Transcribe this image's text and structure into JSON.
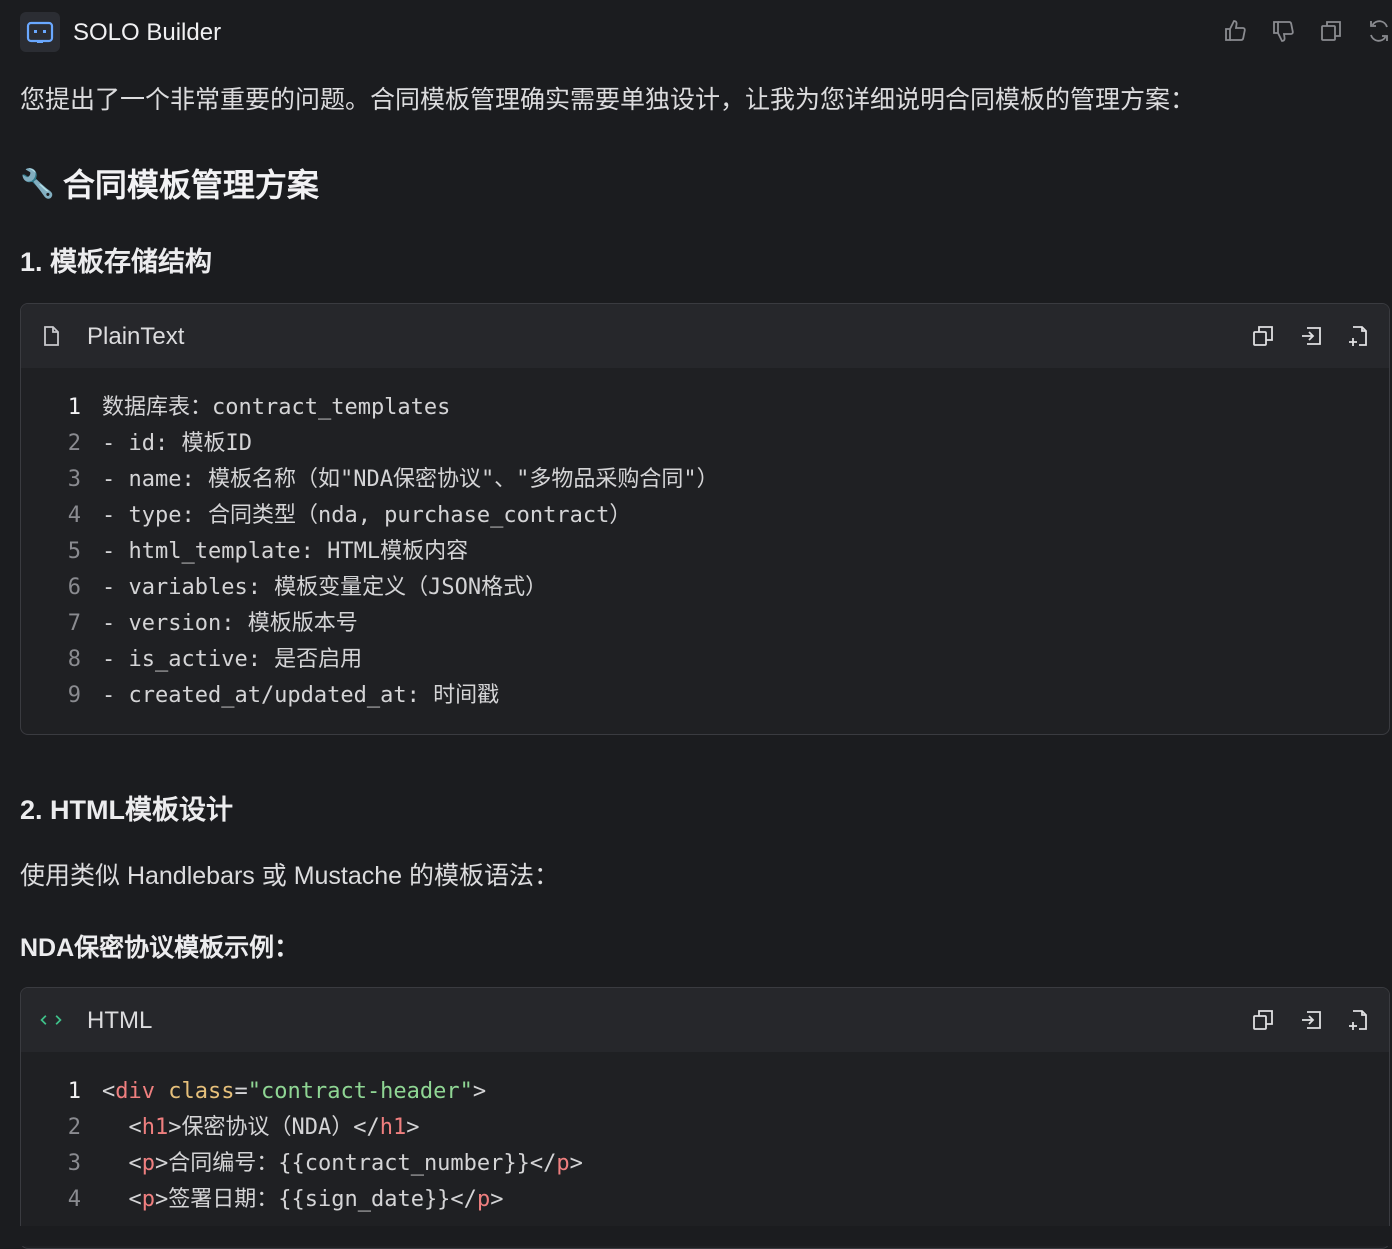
{
  "header": {
    "app_name": "SOLO Builder",
    "actions": [
      "thumbs-up",
      "thumbs-down",
      "copy",
      "regenerate"
    ]
  },
  "message": {
    "intro": "您提出了一个非常重要的问题。合同模板管理确实需要单独设计，让我为您详细说明合同模板的管理方案：",
    "section_title": "合同模板管理方案",
    "section_emoji": "🔧",
    "sub1_title": "1. 模板存储结构",
    "sub2_title": "2. HTML模板设计",
    "sub2_para": "使用类似 Handlebars 或 Mustache 的模板语法：",
    "sub2_bold": "NDA保密协议模板示例："
  },
  "code1": {
    "language": "PlainText",
    "lines": [
      "数据库表：contract_templates",
      "- id: 模板ID",
      "- name: 模板名称（如\"NDA保密协议\"、\"多物品采购合同\"）",
      "- type: 合同类型（nda, purchase_contract）",
      "- html_template: HTML模板内容",
      "- variables: 模板变量定义（JSON格式）",
      "- version: 模板版本号",
      "- is_active: 是否启用",
      "- created_at/updated_at: 时间戳"
    ]
  },
  "code2": {
    "language": "HTML",
    "lines": [
      [
        [
          "punc",
          "<"
        ],
        [
          "tag",
          "div"
        ],
        [
          "punc",
          " "
        ],
        [
          "attr",
          "class"
        ],
        [
          "punc",
          "="
        ],
        [
          "str",
          "\"contract-header\""
        ],
        [
          "punc",
          ">"
        ]
      ],
      [
        [
          "punc",
          "  <"
        ],
        [
          "tag",
          "h1"
        ],
        [
          "punc",
          ">保密协议（NDA）</"
        ],
        [
          "tag",
          "h1"
        ],
        [
          "punc",
          ">"
        ]
      ],
      [
        [
          "punc",
          "  <"
        ],
        [
          "tag",
          "p"
        ],
        [
          "punc",
          ">合同编号：{{contract_number}}</"
        ],
        [
          "tag",
          "p"
        ],
        [
          "punc",
          ">"
        ]
      ],
      [
        [
          "punc",
          "  <"
        ],
        [
          "tag",
          "p"
        ],
        [
          "punc",
          ">签署日期：{{sign_date}}</"
        ],
        [
          "tag",
          "p"
        ],
        [
          "punc",
          ">"
        ]
      ]
    ]
  },
  "colors": {
    "background": "#1b1c1f",
    "code_header": "#26272b",
    "tag": "#ef7f7f",
    "attr": "#e6c07b",
    "string": "#8fd694",
    "html_icon": "#3fc28a"
  }
}
